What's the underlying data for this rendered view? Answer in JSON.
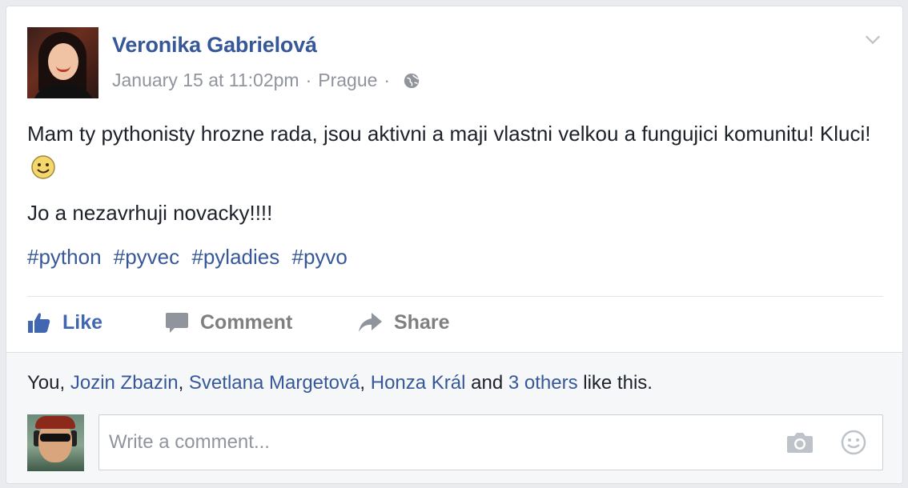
{
  "post": {
    "author": "Veronika Gabrielová",
    "date": "January 15 at 11:02pm",
    "location": "Prague",
    "sep1": "·",
    "sep2": "·",
    "privacy_icon": "globe-icon",
    "text_line1": "Mam ty pythonisty hrozne rada, jsou aktivni a maji vlastni velkou a fungujici komunitu! Kluci!",
    "text_line2": "Jo a nezavrhuji novacky!!!!",
    "hashtags": [
      "#python",
      "#pyvec",
      "#pyladies",
      "#pyvo"
    ]
  },
  "actions": {
    "like": "Like",
    "comment": "Comment",
    "share": "Share"
  },
  "likes": {
    "you": "You,",
    "people": [
      "Jozin Zbazin",
      "Svetlana Margetová",
      "Honza Král"
    ],
    "comma": ",",
    "and": "and",
    "others": "3 others",
    "suffix": "like this."
  },
  "comment_input": {
    "placeholder": "Write a comment...",
    "value": ""
  },
  "colors": {
    "link": "#365899",
    "like_blue": "#4267b2",
    "meta_gray": "#90949c"
  }
}
